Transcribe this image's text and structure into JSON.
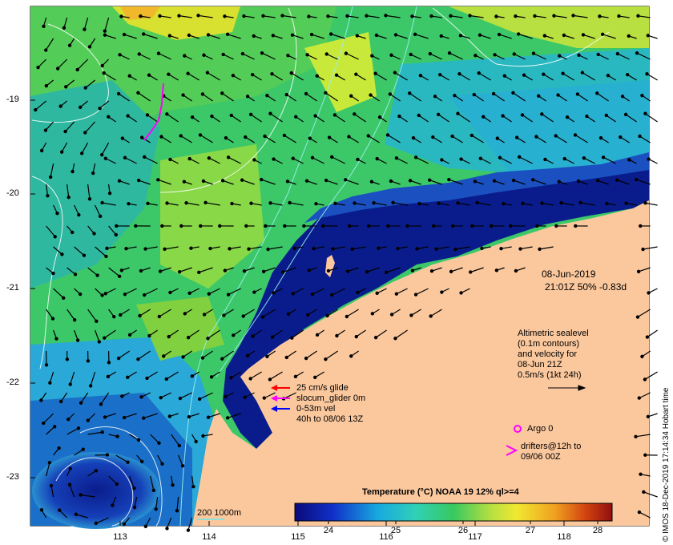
{
  "map": {
    "lat_ticks": [
      "-19",
      "-20",
      "-21",
      "-22",
      "-23"
    ],
    "lon_ticks": [
      "113",
      "114",
      "115",
      "116",
      "117",
      "118"
    ],
    "colors": {
      "land": "#fbc89e",
      "deep_cold": "#0a1c8c",
      "cool": "#1fbfd8",
      "mid": "#36c85c",
      "warm": "#c8e83a",
      "hot": "#f0b82a",
      "contour": "#9af0f0"
    }
  },
  "info_panel": {
    "date": "08-Jun-2019",
    "time_line": "21:01Z  50% -0.83d",
    "altimetry_lines": [
      "Altimetric sealevel",
      "(0.1m contours)",
      "and velocity for",
      "08-Jun 21Z",
      "0.5m/s (1kt 24h)"
    ],
    "argo_label": "Argo 0",
    "drifters_lines": [
      "drifters@12h to",
      "09/06 00Z"
    ]
  },
  "glider_legend": {
    "lines": [
      "25 cm/s glide",
      "slocum_glider 0m",
      "0-53m vel",
      "40h to 08/06 13Z"
    ],
    "arrow_colors": [
      "#ff0000",
      "#ff00ff",
      "#0000ff"
    ]
  },
  "contour_legend": {
    "label": "200  1000m"
  },
  "colorbar": {
    "title": "Temperature (°C) NOAA 19 12% ql>=4",
    "ticks": [
      "24",
      "25",
      "26",
      "27",
      "28"
    ],
    "range": [
      23.6,
      28.3
    ]
  },
  "credit": "© IMOS 18-Dec-2019 17:14:34 Hobart time"
}
